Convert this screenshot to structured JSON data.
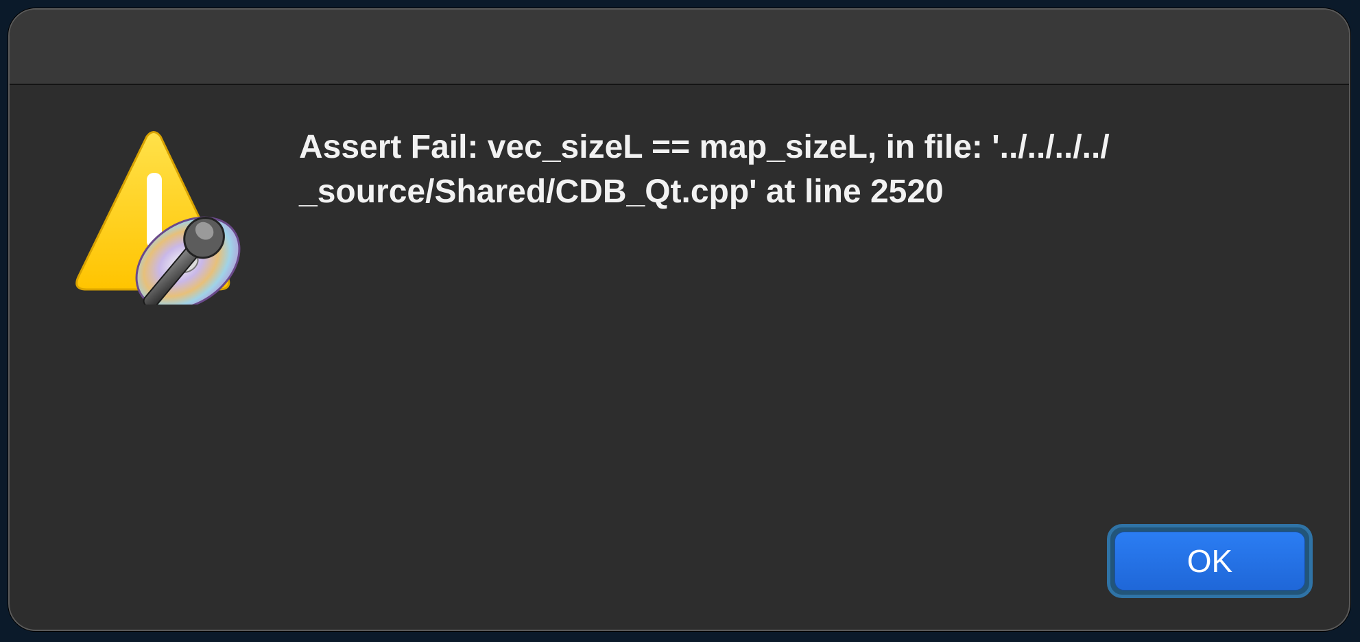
{
  "dialog": {
    "message": "Assert Fail: vec_sizeL == map_sizeL, in file: '../../../../\n_source/Shared/CDB_Qt.cpp' at line 2520",
    "ok_label": "OK",
    "icon": "warning-triangle-with-microphone-disc-icon"
  },
  "colors": {
    "background": "#0b1a2a",
    "dialog": "#2d2d2d",
    "titlebar": "#393939",
    "text": "#f2f2f2",
    "accent": "#2b7df3",
    "warning": "#ffcc00"
  }
}
